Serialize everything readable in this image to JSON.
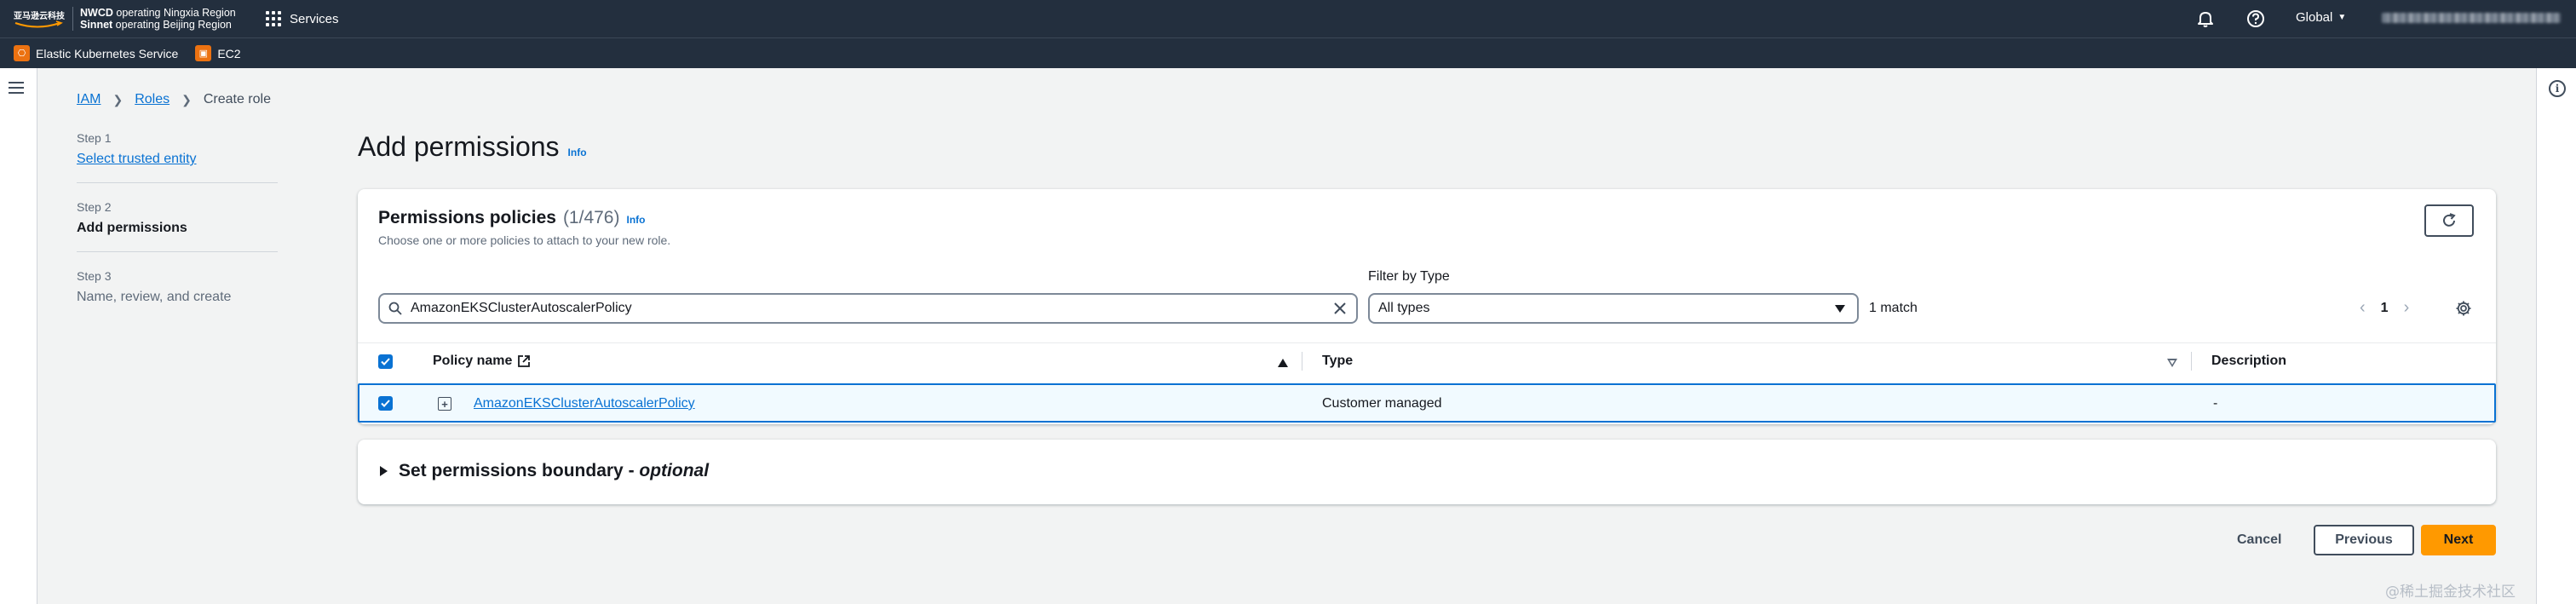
{
  "topnav": {
    "logo_text": "亚马逊云科技",
    "region_line1_bold": "NWCD",
    "region_line1": " operating Ningxia Region",
    "region_line2_bold": "Sinnet",
    "region_line2": " operating Beijing Region",
    "services_label": "Services",
    "global_label": "Global"
  },
  "favorites": [
    {
      "label": "Elastic Kubernetes Service",
      "icon": "eks-service-icon"
    },
    {
      "label": "EC2",
      "icon": "ec2-service-icon"
    }
  ],
  "breadcrumb": {
    "items": [
      "IAM",
      "Roles"
    ],
    "current": "Create role"
  },
  "steps": [
    {
      "number": "Step 1",
      "label": "Select trusted entity"
    },
    {
      "number": "Step 2",
      "label": "Add permissions"
    },
    {
      "number": "Step 3",
      "label": "Name, review, and create"
    }
  ],
  "page": {
    "title": "Add permissions",
    "info": "Info"
  },
  "policies": {
    "title": "Permissions policies",
    "count": "(1/476)",
    "info": "Info",
    "description": "Choose one or more policies to attach to your new role.",
    "filter_label": "Filter by Type",
    "search_value": "AmazonEKSClusterAutoscalerPolicy",
    "type_value": "All types",
    "match_count": "1 match",
    "page_number": "1",
    "columns": [
      "Policy name",
      "Type",
      "Description"
    ],
    "rows": [
      {
        "name": "AmazonEKSClusterAutoscalerPolicy",
        "type": "Customer managed",
        "description": "-",
        "selected": true
      }
    ]
  },
  "boundary": {
    "label": "Set permissions boundary - ",
    "optional": "optional"
  },
  "actions": {
    "cancel": "Cancel",
    "previous": "Previous",
    "next": "Next"
  },
  "watermark": "@稀土掘金技术社区",
  "colors": {
    "nav_bg": "#232f3e",
    "link": "#0972d3",
    "primary_button": "#ff9900",
    "selected_row_bg": "#f1faff"
  }
}
